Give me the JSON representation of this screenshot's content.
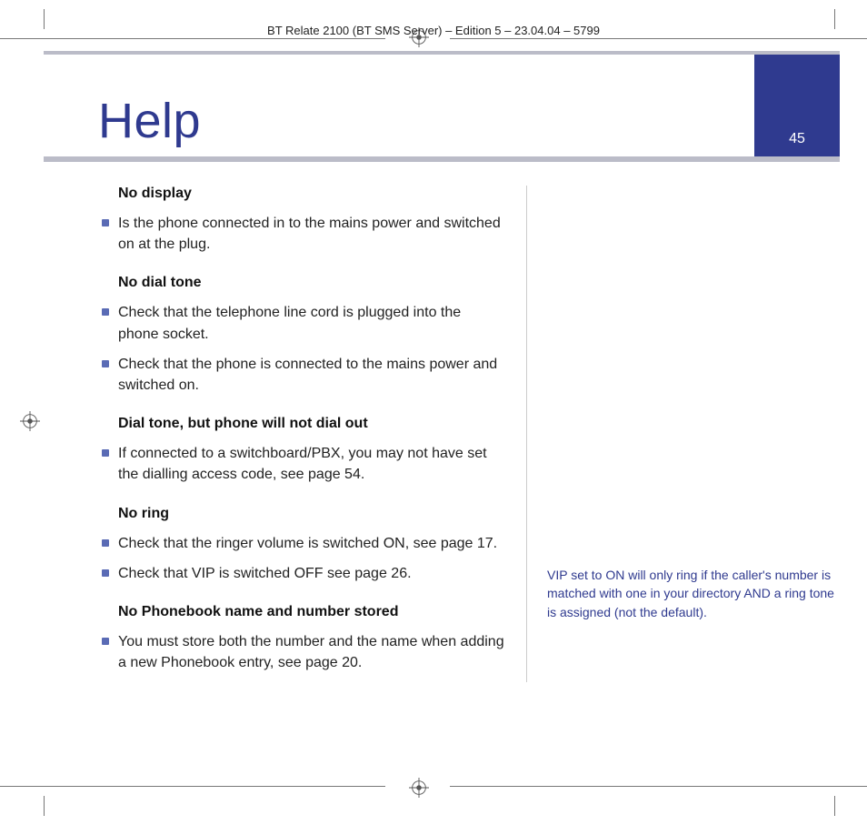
{
  "doc_header": "BT Relate 2100 (BT SMS Server) – Edition 5 – 23.04.04 – 5799",
  "title": "Help",
  "page_number": "45",
  "sections": [
    {
      "heading": "No display",
      "items": [
        "Is the phone connected in to the mains power and switched on at the plug."
      ]
    },
    {
      "heading": "No dial tone",
      "items": [
        "Check that the telephone line cord is plugged into the phone socket.",
        "Check that the phone is connected to the mains power and switched on."
      ]
    },
    {
      "heading": "Dial tone, but phone will not dial out",
      "items": [
        "If connected to a switchboard/PBX, you may not have set the dialling access code, see page 54."
      ]
    },
    {
      "heading": "No ring",
      "items": [
        "Check that the ringer volume is switched ON, see page 17.",
        "Check that VIP is switched OFF see page 26."
      ]
    },
    {
      "heading": "No Phonebook name and number stored",
      "items": [
        "You must store both the number and the name when adding a new Phonebook entry, see page 20."
      ]
    }
  ],
  "sidenote": "VIP set to ON will only ring if the caller's number is matched with one in your directory AND a ring tone is assigned (not the default)."
}
